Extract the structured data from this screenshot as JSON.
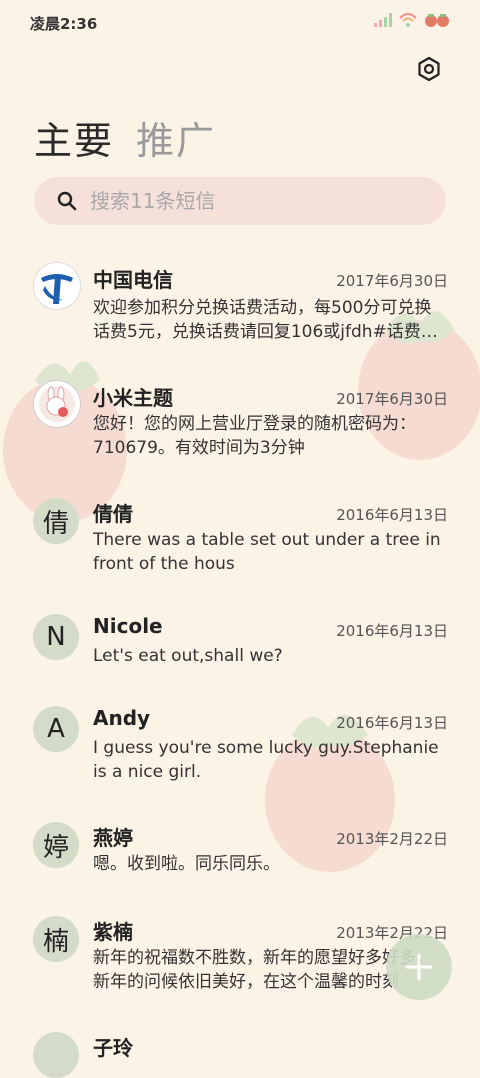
{
  "status_bar": {
    "time": "凌晨2:36"
  },
  "tabs": [
    {
      "label": "主要"
    },
    {
      "label": "推广"
    }
  ],
  "search": {
    "placeholder": "搜索11条短信"
  },
  "conversations": [
    {
      "avatar": "",
      "name": "中国电信",
      "date": "2017年6月30日",
      "preview": "欢迎参加积分兑换话费活动，每500分可兑换话费5元，兑换话费请回复106或jfdh#话费…"
    },
    {
      "avatar": "",
      "name": "小米主题",
      "date": "2017年6月30日",
      "preview": "您好！您的网上营业厅登录的随机密码为：710679。有效时间为3分钟"
    },
    {
      "avatar": "倩",
      "name": "倩倩",
      "date": "2016年6月13日",
      "preview": "There was a table set out under a tree in front of the hous"
    },
    {
      "avatar": "N",
      "name": "Nicole",
      "date": "2016年6月13日",
      "preview": "Let's eat out,shall we?"
    },
    {
      "avatar": "A",
      "name": "Andy",
      "date": "2016年6月13日",
      "preview": "I guess you're some lucky guy.Stephanie is a nice girl."
    },
    {
      "avatar": "婷",
      "name": "燕婷",
      "date": "2013年2月22日",
      "preview": "嗯。收到啦。同乐同乐。"
    },
    {
      "avatar": "楠",
      "name": "紫楠",
      "date": "2013年2月22日",
      "preview": "新年的祝福数不胜数，新年的愿望好多好多，新年的问候依旧美好，在这个温馨的时刻"
    },
    {
      "avatar": "",
      "name": "子玲",
      "date": "",
      "preview": ""
    }
  ],
  "colors": {
    "background": "#fbf3e6",
    "search_bg": "#f6e1da",
    "avatar_bg": "#d4dcc9",
    "fab_bg": "#cfdcc6",
    "telecom_blue": "#1d5fb0"
  },
  "icons": {
    "settings": "settings-icon",
    "search": "search-icon",
    "fab": "plus-icon"
  }
}
